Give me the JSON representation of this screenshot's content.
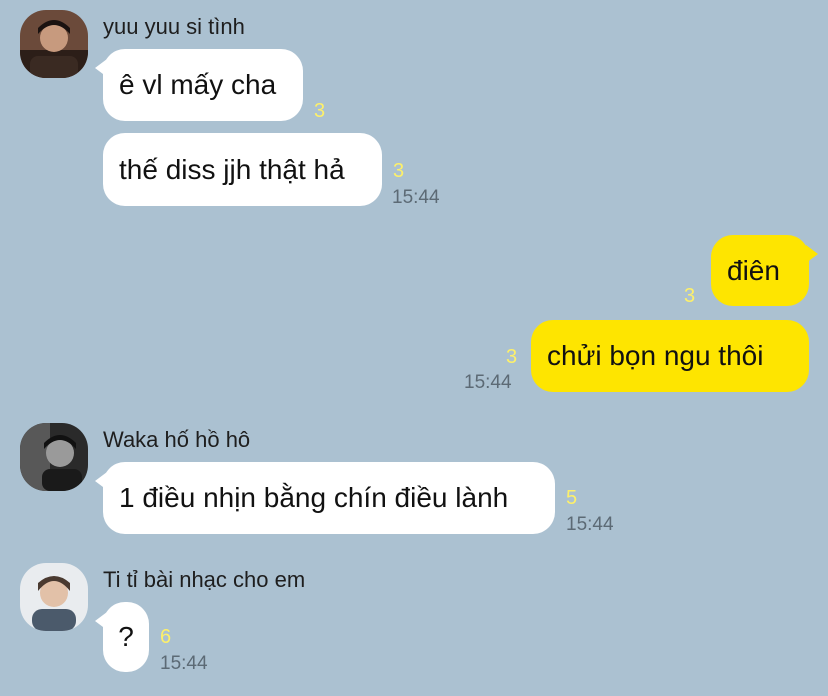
{
  "colors": {
    "background": "#abc1d1",
    "incoming_bubble": "#ffffff",
    "outgoing_bubble": "#fee500",
    "unread_count": "#fdf06a",
    "timestamp": "#5c6a75"
  },
  "groups": [
    {
      "sender": "yuu yuu si tình",
      "messages": [
        {
          "text": "ê vl mấy cha",
          "unread": "3",
          "time": ""
        },
        {
          "text": "thế diss jjh thật hả",
          "unread": "3",
          "time": "15:44"
        }
      ]
    },
    {
      "sender": "",
      "messages": [
        {
          "text": "điên",
          "unread": "3",
          "time": ""
        },
        {
          "text": "chửi bọn ngu thôi",
          "unread": "3",
          "time": "15:44"
        }
      ]
    },
    {
      "sender": "Waka hố hồ hô",
      "messages": [
        {
          "text": "1 điều nhịn bằng chín điều lành",
          "unread": "5",
          "time": "15:44"
        }
      ]
    },
    {
      "sender": "Ti tỉ bài nhạc cho em",
      "messages": [
        {
          "text": "?",
          "unread": "6",
          "time": "15:44"
        }
      ]
    }
  ]
}
